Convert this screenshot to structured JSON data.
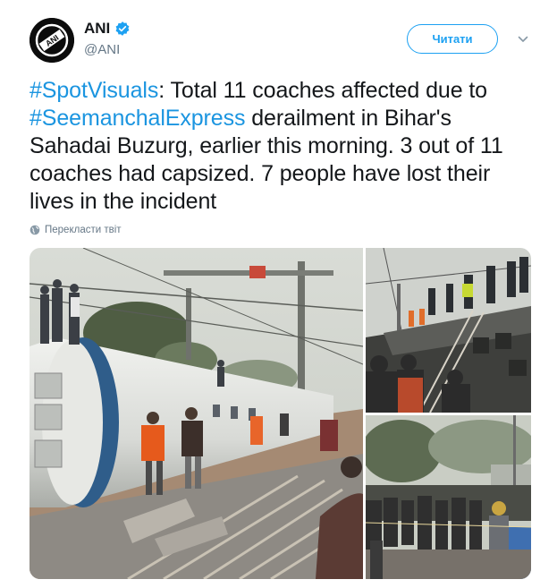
{
  "tweet": {
    "author_name": "ANI",
    "author_handle": "@ANI",
    "avatar_text": "ANI",
    "follow_label": "Читати",
    "text_segments": [
      {
        "text": "#SpotVisuals",
        "type": "hashtag"
      },
      {
        "text": ": Total 11 coaches affected due to ",
        "type": "text"
      },
      {
        "text": "#SeemanchalExpress",
        "type": "hashtag"
      },
      {
        "text": " derailment in Bihar's Sahadai Buzurg, earlier this morning. 3 out of 11 coaches had capsized. 7 people have lost their lives in the incident",
        "type": "text"
      }
    ],
    "translate_label": "Перекласти твіт"
  },
  "icons": {
    "verified": "verified-badge-icon",
    "menu": "chevron-down-icon",
    "translate": "globe-icon"
  },
  "colors": {
    "link": "#1b95e0",
    "accent": "#1da1f2",
    "muted": "#657786",
    "text": "#14171a"
  },
  "media": {
    "photos": [
      {
        "name": "derailed-coach-photo"
      },
      {
        "name": "capsized-coaches-crowd-photo"
      },
      {
        "name": "crowd-at-site-photo"
      }
    ]
  }
}
